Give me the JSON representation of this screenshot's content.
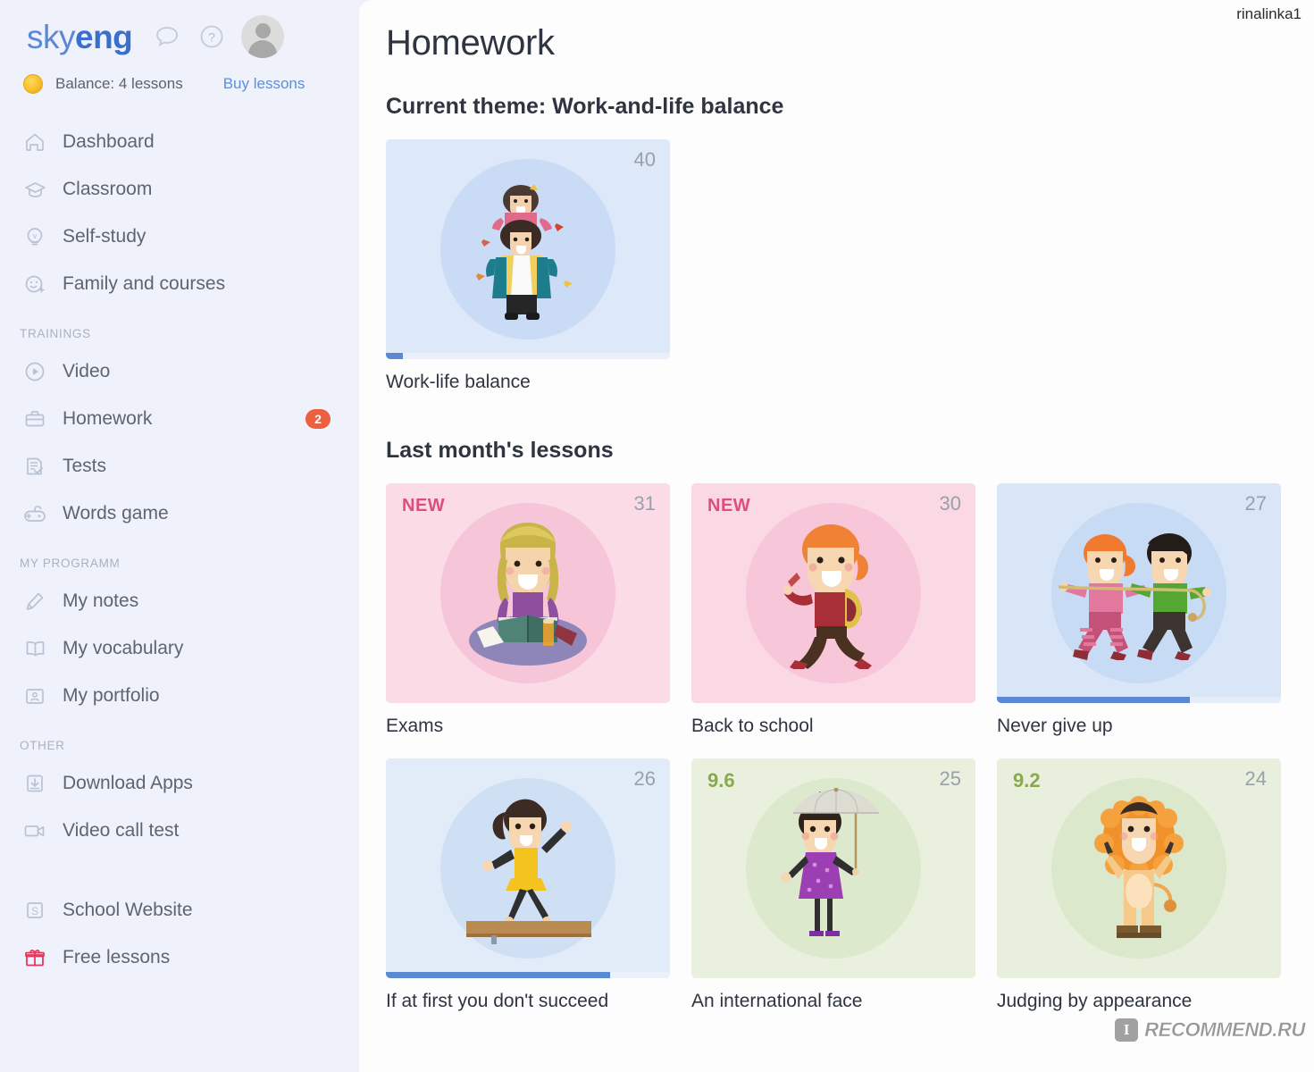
{
  "brand": {
    "part1": "sky",
    "part2": "eng"
  },
  "header": {
    "chat_icon": "chat-bubble-icon",
    "help_icon": "question-mark-icon",
    "avatar_icon": "user-avatar-icon",
    "balance_label": "Balance: 4 lessons",
    "buy_lessons_label": "Buy lessons",
    "coin_icon": "coin-icon"
  },
  "sidebar": {
    "items": [
      {
        "label": "Dashboard",
        "icon": "home-icon"
      },
      {
        "label": "Classroom",
        "icon": "graduation-cap-icon"
      },
      {
        "label": "Self-study",
        "icon": "lightbulb-icon"
      },
      {
        "label": "Family and courses",
        "icon": "smiley-plus-icon"
      }
    ],
    "section_trainings": "TRAININGS",
    "trainings": [
      {
        "label": "Video",
        "icon": "play-circle-icon"
      },
      {
        "label": "Homework",
        "icon": "briefcase-icon",
        "badge": "2"
      },
      {
        "label": "Tests",
        "icon": "checklist-icon"
      },
      {
        "label": "Words game",
        "icon": "gamepad-icon"
      }
    ],
    "section_my_programm": "MY PROGRAMM",
    "my_programm": [
      {
        "label": "My notes",
        "icon": "pencil-icon"
      },
      {
        "label": "My vocabulary",
        "icon": "open-book-icon"
      },
      {
        "label": "My portfolio",
        "icon": "portfolio-person-icon"
      }
    ],
    "section_other": "OTHER",
    "other": [
      {
        "label": "Download Apps",
        "icon": "download-icon"
      },
      {
        "label": "Video call test",
        "icon": "video-camera-icon"
      }
    ],
    "footer": [
      {
        "label": "School Website",
        "icon": "s-square-icon"
      },
      {
        "label": "Free lessons",
        "icon": "gift-icon"
      }
    ]
  },
  "main": {
    "page_title": "Homework",
    "current_theme_title": "Current theme: Work-and-life balance",
    "last_month_title": "Last month's lessons",
    "current_theme_cards": [
      {
        "label": "Work-life balance",
        "number": "40",
        "badge": "",
        "score": "",
        "progress_percent": 6,
        "bg": "#dde8f8",
        "blob": "#cadcf5",
        "track": "#e9eff8",
        "art": "father-daughter-autumn"
      }
    ],
    "last_month_cards": [
      {
        "label": "Exams",
        "number": "31",
        "badge": "NEW",
        "score": "",
        "progress_percent": 0,
        "bg": "#fadbe6",
        "blob": "#f6c5d8",
        "track": "",
        "art": "girl-reading-book"
      },
      {
        "label": "Back to school",
        "number": "30",
        "badge": "NEW",
        "score": "",
        "progress_percent": 0,
        "bg": "#fbd9e4",
        "blob": "#f7c6d9",
        "track": "",
        "art": "girl-running-backpack"
      },
      {
        "label": "Never give up",
        "number": "27",
        "badge": "",
        "score": "",
        "progress_percent": 68,
        "bg": "#d9e6f8",
        "blob": "#c7dbf4",
        "track": "#e5edf9",
        "art": "kids-tug-of-war"
      },
      {
        "label": "If at first you don't succeed",
        "number": "26",
        "badge": "",
        "score": "",
        "progress_percent": 79,
        "bg": "#e2ecf9",
        "blob": "#cfe0f5",
        "track": "#eaf1fa",
        "art": "girl-balance-beam"
      },
      {
        "label": "An international face",
        "number": "25",
        "badge": "",
        "score": "9.6",
        "progress_percent": 0,
        "bg": "#e9f1de",
        "blob": "#dce9cc",
        "track": "",
        "art": "girl-parasol"
      },
      {
        "label": "Judging by appearance",
        "number": "24",
        "badge": "",
        "score": "9.2",
        "progress_percent": 0,
        "bg": "#e8f0dd",
        "blob": "#dbe8cb",
        "track": "",
        "art": "boy-lion-costume"
      }
    ]
  },
  "watermarks": {
    "user": "rinalinka1",
    "recommend_mark": "I",
    "recommend_text": "RECOMMEND.RU"
  },
  "colors": {
    "accent_blue": "#3a6fd0",
    "badge_red": "#ec6040",
    "new_pink": "#de4d80",
    "score_green": "#8aa84e",
    "progress_blue": "#5a8ad2"
  }
}
